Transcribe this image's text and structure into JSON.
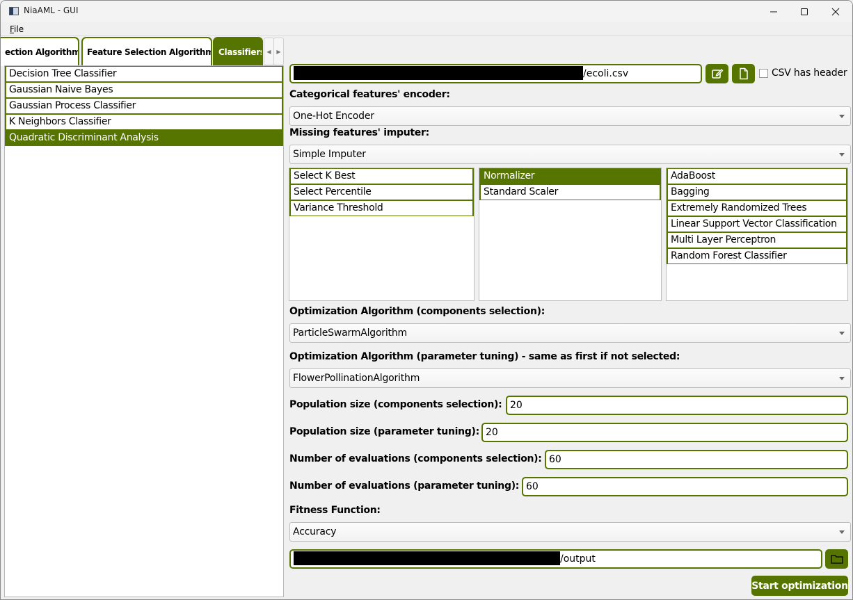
{
  "window": {
    "title": "NiaAML - GUI",
    "minimize_icon": "minimize-icon",
    "maximize_icon": "maximize-icon",
    "close_icon": "close-icon"
  },
  "menu": {
    "items": [
      {
        "label": "File",
        "mnemonic": "F"
      }
    ]
  },
  "tabs": {
    "items": [
      {
        "label": "ection Algorithms",
        "active": false
      },
      {
        "label": "Feature Selection Algorithms",
        "active": false
      },
      {
        "label": "Classifiers",
        "active": true
      }
    ],
    "scroll_left_icon": "arrow-left-icon",
    "scroll_right_icon": "arrow-right-icon"
  },
  "classifiers_list": {
    "items": [
      {
        "label": "Decision Tree Classifier",
        "selected": false
      },
      {
        "label": "Gaussian Naive Bayes",
        "selected": false
      },
      {
        "label": "Gaussian Process Classifier",
        "selected": false
      },
      {
        "label": "K Neighbors Classifier",
        "selected": false
      },
      {
        "label": "Quadratic Discriminant Analysis",
        "selected": true
      }
    ]
  },
  "csv": {
    "path_suffix": "/ecoli.csv",
    "edit_icon": "edit-icon",
    "file_icon": "file-icon",
    "has_header_label": "CSV has header",
    "has_header_checked": false
  },
  "encoder": {
    "label": "Categorical features' encoder:",
    "value": "One-Hot Encoder"
  },
  "imputer": {
    "label": "Missing features' imputer:",
    "value": "Simple Imputer"
  },
  "feature_selection_list": {
    "items": [
      {
        "label": "Select K Best",
        "selected": false
      },
      {
        "label": "Select Percentile",
        "selected": false
      },
      {
        "label": "Variance Threshold",
        "selected": false
      }
    ]
  },
  "feature_transform_list": {
    "items": [
      {
        "label": "Normalizer",
        "selected": true
      },
      {
        "label": "Standard Scaler",
        "selected": false
      }
    ]
  },
  "selected_classifiers_list": {
    "items": [
      {
        "label": "AdaBoost"
      },
      {
        "label": "Bagging"
      },
      {
        "label": "Extremely Randomized Trees"
      },
      {
        "label": "Linear Support Vector Classification"
      },
      {
        "label": "Multi Layer Perceptron"
      },
      {
        "label": "Random Forest Classifier"
      }
    ]
  },
  "opt_components": {
    "label": "Optimization Algorithm (components selection):",
    "value": "ParticleSwarmAlgorithm"
  },
  "opt_tuning": {
    "label": "Optimization Algorithm (parameter tuning) - same as first if not selected:",
    "value": "FlowerPollinationAlgorithm"
  },
  "pop_components": {
    "label": "Population size (components selection):",
    "value": "20"
  },
  "pop_tuning": {
    "label": "Population size (parameter tuning):",
    "value": "20"
  },
  "evals_components": {
    "label": "Number of evaluations (components selection):",
    "value": "60"
  },
  "evals_tuning": {
    "label": "Number of evaluations (parameter tuning):",
    "value": "60"
  },
  "fitness": {
    "label": "Fitness Function:",
    "value": "Accuracy"
  },
  "output": {
    "path_suffix": "/output",
    "folder_icon": "folder-icon"
  },
  "actions": {
    "start_label": "Start optimization"
  },
  "colors": {
    "accent": "#567400",
    "background": "#f0f0f0"
  }
}
